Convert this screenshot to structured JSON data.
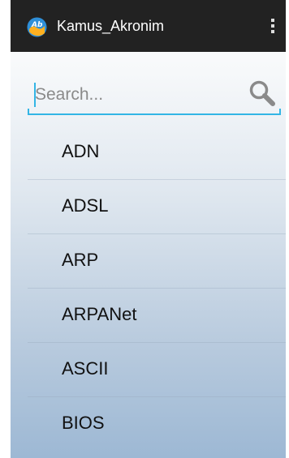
{
  "app": {
    "title": "Kamus_Akronim",
    "icon": "app-logo-icon"
  },
  "search": {
    "placeholder": "Search...",
    "value": "",
    "icon": "search-icon"
  },
  "menu": {
    "icon": "overflow-menu-icon"
  },
  "colors": {
    "action_bar": "#222222",
    "accent": "#33b5e5",
    "text": "#111111"
  },
  "list": {
    "items": [
      {
        "label": "ADN"
      },
      {
        "label": "ADSL"
      },
      {
        "label": "ARP"
      },
      {
        "label": "ARPANet"
      },
      {
        "label": "ASCII"
      },
      {
        "label": "BIOS"
      }
    ]
  }
}
